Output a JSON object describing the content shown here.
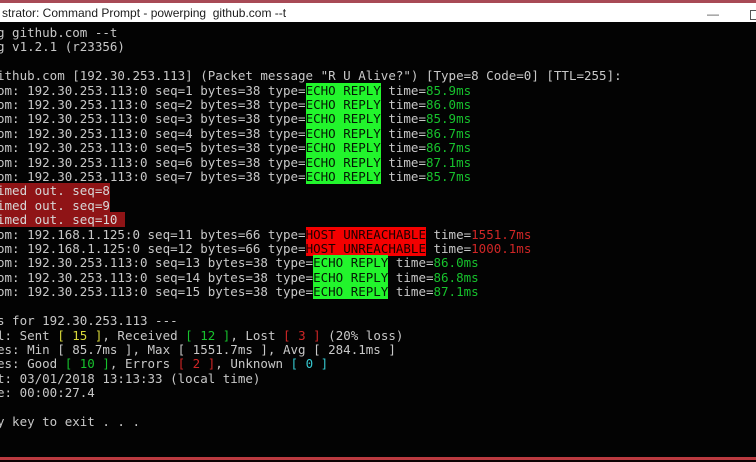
{
  "window": {
    "title": "strator: Command Prompt - powerping  github.com --t",
    "minimize_icon": "—"
  },
  "colors": {
    "accent_top": "#a84a56",
    "accent_bottom": "#bb3a40",
    "console_fg": "#c8c8c8",
    "green_bright": "#22f52c",
    "green_text": "#17c22d",
    "red_bright": "#f40000",
    "red_text": "#cf2626",
    "darkred_bg": "#8f1416",
    "yellow_text": "#d8d83a",
    "cyan_text": "#35c7cf"
  },
  "console": {
    "lines": [
      {
        "segments": [
          {
            "text": "g github.com --t",
            "color": "default"
          }
        ]
      },
      {
        "segments": [
          {
            "text": "g v1.2.1 (r23356)",
            "color": "default"
          }
        ]
      },
      {
        "segments": []
      },
      {
        "segments": [
          {
            "text": "ithub.com [192.30.253.113] (Packet message \"R U Alive?\") [Type=8 Code=0] [TTL=255]:",
            "color": "default"
          }
        ]
      },
      {
        "segments": [
          {
            "text": "om: 192.30.253.113:0 seq=1 bytes=38 type=",
            "color": "default"
          },
          {
            "text": "ECHO REPLY",
            "color": "hl-green"
          },
          {
            "text": " time=",
            "color": "default"
          },
          {
            "text": "85.9ms",
            "color": "green"
          }
        ]
      },
      {
        "segments": [
          {
            "text": "om: 192.30.253.113:0 seq=2 bytes=38 type=",
            "color": "default"
          },
          {
            "text": "ECHO REPLY",
            "color": "hl-green"
          },
          {
            "text": " time=",
            "color": "default"
          },
          {
            "text": "86.0ms",
            "color": "green"
          }
        ]
      },
      {
        "segments": [
          {
            "text": "om: 192.30.253.113:0 seq=3 bytes=38 type=",
            "color": "default"
          },
          {
            "text": "ECHO REPLY",
            "color": "hl-green"
          },
          {
            "text": " time=",
            "color": "default"
          },
          {
            "text": "85.9ms",
            "color": "green"
          }
        ]
      },
      {
        "segments": [
          {
            "text": "om: 192.30.253.113:0 seq=4 bytes=38 type=",
            "color": "default"
          },
          {
            "text": "ECHO REPLY",
            "color": "hl-green"
          },
          {
            "text": " time=",
            "color": "default"
          },
          {
            "text": "86.7ms",
            "color": "green"
          }
        ]
      },
      {
        "segments": [
          {
            "text": "om: 192.30.253.113:0 seq=5 bytes=38 type=",
            "color": "default"
          },
          {
            "text": "ECHO REPLY",
            "color": "hl-green"
          },
          {
            "text": " time=",
            "color": "default"
          },
          {
            "text": "86.7ms",
            "color": "green"
          }
        ]
      },
      {
        "segments": [
          {
            "text": "om: 192.30.253.113:0 seq=6 bytes=38 type=",
            "color": "default"
          },
          {
            "text": "ECHO REPLY",
            "color": "hl-green"
          },
          {
            "text": " time=",
            "color": "default"
          },
          {
            "text": "87.1ms",
            "color": "green"
          }
        ]
      },
      {
        "segments": [
          {
            "text": "om: 192.30.253.113:0 seq=7 bytes=38 type=",
            "color": "default"
          },
          {
            "text": "ECHO REPLY",
            "color": "hl-green"
          },
          {
            "text": " time=",
            "color": "default"
          },
          {
            "text": "85.7ms",
            "color": "green"
          }
        ]
      },
      {
        "segments": [
          {
            "text": "imed out. seq=8",
            "color": "hl-darkred"
          }
        ]
      },
      {
        "segments": [
          {
            "text": "imed out. seq=9",
            "color": "hl-darkred"
          }
        ]
      },
      {
        "segments": [
          {
            "text": "imed out. seq=10 ",
            "color": "hl-darkred"
          }
        ]
      },
      {
        "segments": [
          {
            "text": "om: 192.168.1.125:0 seq=11 bytes=66 type=",
            "color": "default"
          },
          {
            "text": "HOST UNREACHABLE",
            "color": "hl-red"
          },
          {
            "text": " time=",
            "color": "default"
          },
          {
            "text": "1551.7ms",
            "color": "red"
          }
        ]
      },
      {
        "segments": [
          {
            "text": "om: 192.168.1.125:0 seq=12 bytes=66 type=",
            "color": "default"
          },
          {
            "text": "HOST UNREACHABLE",
            "color": "hl-red"
          },
          {
            "text": " time=",
            "color": "default"
          },
          {
            "text": "1000.1ms",
            "color": "red"
          }
        ]
      },
      {
        "segments": [
          {
            "text": "om: 192.30.253.113:0 seq=13 bytes=38 type=",
            "color": "default"
          },
          {
            "text": "ECHO REPLY",
            "color": "hl-green"
          },
          {
            "text": " time=",
            "color": "default"
          },
          {
            "text": "86.0ms",
            "color": "green"
          }
        ]
      },
      {
        "segments": [
          {
            "text": "om: 192.30.253.113:0 seq=14 bytes=38 type=",
            "color": "default"
          },
          {
            "text": "ECHO REPLY",
            "color": "hl-green"
          },
          {
            "text": " time=",
            "color": "default"
          },
          {
            "text": "86.8ms",
            "color": "green"
          }
        ]
      },
      {
        "segments": [
          {
            "text": "om: 192.30.253.113:0 seq=15 bytes=38 type=",
            "color": "default"
          },
          {
            "text": "ECHO REPLY",
            "color": "hl-green"
          },
          {
            "text": " time=",
            "color": "default"
          },
          {
            "text": "87.1ms",
            "color": "green"
          }
        ]
      },
      {
        "segments": []
      },
      {
        "segments": [
          {
            "text": "s for 192.30.253.113 ---",
            "color": "default"
          }
        ]
      },
      {
        "segments": [
          {
            "text": "l: Sent ",
            "color": "default"
          },
          {
            "text": "[ 15 ]",
            "color": "yellow"
          },
          {
            "text": ", Received ",
            "color": "default"
          },
          {
            "text": "[ 12 ]",
            "color": "green"
          },
          {
            "text": ", Lost ",
            "color": "default"
          },
          {
            "text": "[ 3 ]",
            "color": "red"
          },
          {
            "text": " (20% loss)",
            "color": "default"
          }
        ]
      },
      {
        "segments": [
          {
            "text": "es: Min [ 85.7ms ], Max [ 1551.7ms ], Avg [ 284.1ms ]",
            "color": "default"
          }
        ]
      },
      {
        "segments": [
          {
            "text": "es: Good ",
            "color": "default"
          },
          {
            "text": "[ 10 ]",
            "color": "green"
          },
          {
            "text": ", Errors ",
            "color": "default"
          },
          {
            "text": "[ 2 ]",
            "color": "red"
          },
          {
            "text": ", Unknown ",
            "color": "default"
          },
          {
            "text": "[ 0 ]",
            "color": "cyan"
          }
        ]
      },
      {
        "segments": [
          {
            "text": "t: 03/01/2018 13:13:33 (local time)",
            "color": "default"
          }
        ]
      },
      {
        "segments": [
          {
            "text": "e: 00:00:27.4",
            "color": "default"
          }
        ]
      },
      {
        "segments": []
      },
      {
        "segments": [
          {
            "text": "y key to exit . . .",
            "color": "default"
          }
        ]
      }
    ]
  }
}
